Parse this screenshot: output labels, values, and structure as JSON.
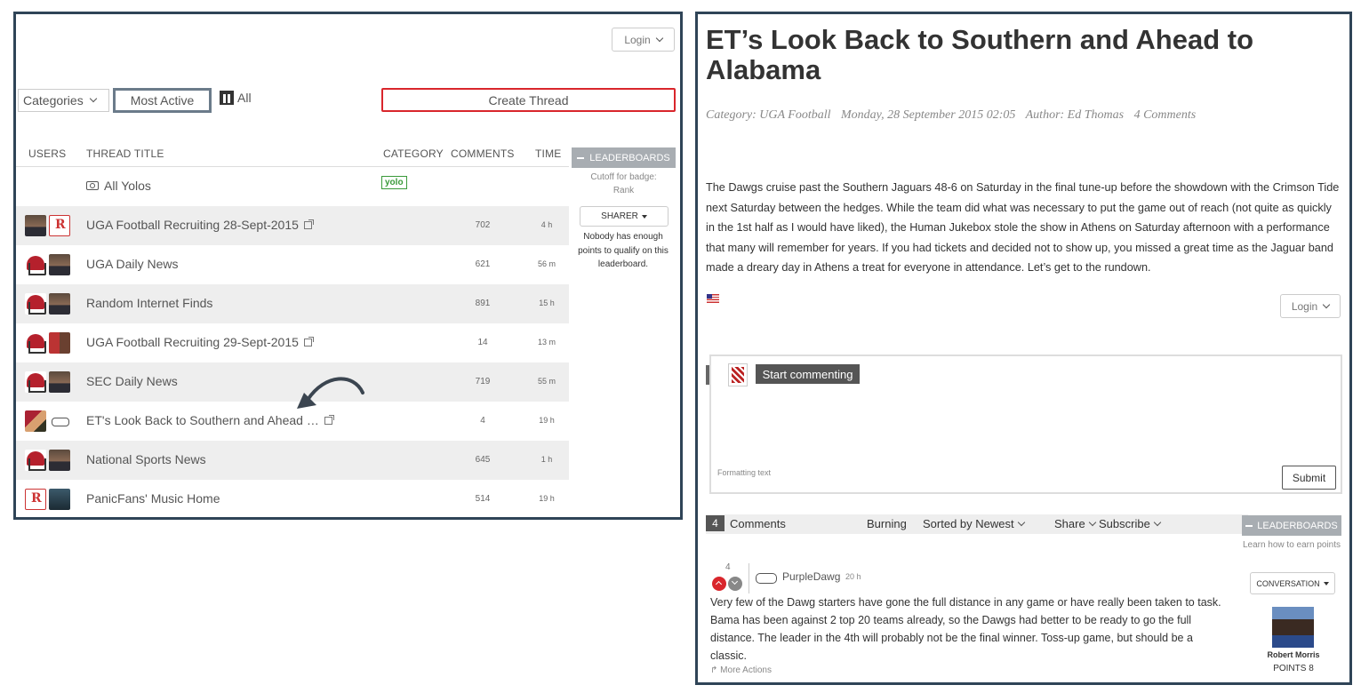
{
  "left": {
    "login_label": "Login",
    "toolbar": {
      "categories_label": "Categories",
      "most_active_label": "Most Active",
      "all_label": "All",
      "create_thread_label": "Create Thread"
    },
    "columns": {
      "users": "USERS",
      "thread_title": "THREAD TITLE",
      "category": "CATEGORY",
      "comments": "COMMENTS",
      "time": "TIME"
    },
    "sidebar": {
      "leaderboards_label": "LEADERBOARDS",
      "cutoff_line1": "Cutoff for badge:",
      "cutoff_line2": "Rank",
      "sharer_label": "SHARER",
      "nobody_text": "Nobody has enough points to qualify on this leaderboard."
    },
    "rows": [
      {
        "title": "All Yolos",
        "category_badge": "yolo",
        "comments": "",
        "time": "",
        "avatars": []
      },
      {
        "title": "UGA Football Recruiting 28-Sept-2015",
        "comments": "702",
        "time": "4 h",
        "avatars": [
          "man",
          "logo"
        ]
      },
      {
        "title": "UGA Daily News",
        "comments": "621",
        "time": "56 m",
        "avatars": [
          "helmet",
          "man"
        ]
      },
      {
        "title": "Random Internet Finds",
        "comments": "891",
        "time": "15 h",
        "avatars": [
          "helmet",
          "man"
        ]
      },
      {
        "title": "UGA Football Recruiting 29-Sept-2015",
        "comments": "14",
        "time": "13 m",
        "avatars": [
          "helmet",
          "couple"
        ]
      },
      {
        "title": "SEC Daily News",
        "comments": "719",
        "time": "55 m",
        "avatars": [
          "helmet",
          "man"
        ]
      },
      {
        "title": "ET's Look Back to Southern and Ahead …",
        "comments": "4",
        "time": "19 h",
        "avatars": [
          "group",
          "bone"
        ]
      },
      {
        "title": "National Sports News",
        "comments": "645",
        "time": "1 h",
        "avatars": [
          "helmet",
          "man"
        ]
      },
      {
        "title": "PanicFans' Music Home",
        "comments": "514",
        "time": "19 h",
        "avatars": [
          "logo",
          "dark"
        ]
      }
    ]
  },
  "right": {
    "article": {
      "title": "ET’s Look Back to Southern and Ahead to Alabama",
      "category": "Category: UGA Football",
      "date": "Monday, 28 September 2015 02:05",
      "author": "Author: Ed Thomas",
      "comments_meta": "4 Comments",
      "body": "The Dawgs cruise past the Southern Jaguars 48-6 on Saturday in the final tune-up before the showdown with the Crimson Tide next Saturday between the hedges. While the team did what was necessary to put the game out of reach (not quite as quickly in the 1st half as I would have liked), the Human Jukebox stole the show in Athens on Saturday afternoon with a performance that many will remember for years.  If you had tickets and decided not to show up, you missed a great time as the Jaguar band made a dreary day in Athens a treat for everyone in attendance.  Let’s get to the rundown."
    },
    "login_label": "Login",
    "composer": {
      "start_label": "Start commenting",
      "formatting_label": "Formatting text",
      "submit_label": "Submit"
    },
    "comments_bar": {
      "count": "4",
      "label": "Comments",
      "burning": "Burning",
      "sorted": "Sorted by Newest",
      "share": "Share",
      "subscribe": "Subscribe"
    },
    "sidebar": {
      "leaderboards_label": "LEADERBOARDS",
      "learn_text": "Learn how to earn points",
      "conversation_label": "CONVERSATION",
      "top_user_name": "Robert Morris",
      "top_user_points": "POINTS 8"
    },
    "comment": {
      "votes": "4",
      "author": "PurpleDawg",
      "time": "20 h",
      "text": "Very few of the Dawg starters have gone the full distance in any game or have really been taken to task.  Bama has been against 2 top 20 teams already, so the Dawgs had better to be ready to go the full distance.  The leader in the 4th will probably not be the final winner. Toss-up game, but should be a classic.",
      "more_actions": "More Actions"
    }
  },
  "colors": {
    "panel_border": "#2f4457",
    "create_thread_border": "#d9262c",
    "row_shade": "#eeeeee",
    "leaderboard_bg": "#a8adb2",
    "yolo_green": "#3a9a3a"
  }
}
